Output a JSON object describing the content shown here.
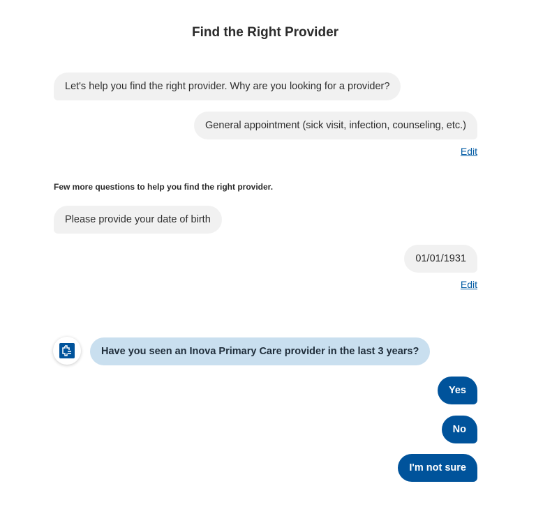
{
  "header": {
    "title": "Find the Right Provider"
  },
  "conversation": {
    "q1": "Let's help you find the right provider. Why are you looking for a provider?",
    "a1": "General appointment (sick visit, infection, counseling, etc.)",
    "edit_label": "Edit",
    "section_note": "Few more questions to help you find the right provider.",
    "q2": "Please provide your date of birth",
    "a2": "01/01/1931",
    "q3": "Have you seen an Inova Primary Care provider in the last 3 years?"
  },
  "options": {
    "yes": "Yes",
    "no": "No",
    "not_sure": "I'm not sure"
  },
  "colors": {
    "accent": "#00539b",
    "question_bubble": "#c9dfef",
    "bubble_gray": "#f1f1f1"
  },
  "icons": {
    "avatar": "inova-logo-icon"
  }
}
